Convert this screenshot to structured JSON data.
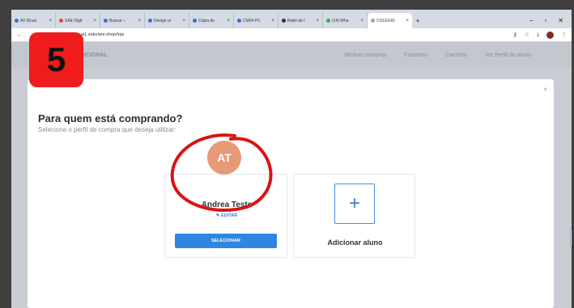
{
  "browser": {
    "tabs": [
      {
        "label": "AV Dicas"
      },
      {
        "label": "SAE Digit"
      },
      {
        "label": "Buscar –"
      },
      {
        "label": "Design ui"
      },
      {
        "label": "Cópia do"
      },
      {
        "label": "CM24-PC"
      },
      {
        "label": "Robô de I"
      },
      {
        "label": "(14) Wha"
      },
      {
        "label": "COLÉGIO"
      }
    ],
    "new_tab": "+",
    "minimize": "−",
    "maximize": "▫",
    "close": "✕",
    "url": "ai1.eskolare.shop/loja"
  },
  "site": {
    "brand": "ADICIONAL",
    "links": [
      "Minhas compras",
      "Favoritos",
      "Carrinho",
      "Ver Perfil do aluno"
    ]
  },
  "modal": {
    "close": "×",
    "title": "Para quem está comprando?",
    "subtitle": "Selecione o perfil de compra que deseja utilizar:",
    "profile": {
      "initials": "AT",
      "name": "Andrea Teste",
      "edit": "EDITAR",
      "select_button": "SELECIONAR"
    },
    "add_card": {
      "plus": "+",
      "label": "Adicionar aluno"
    }
  },
  "step_badge": "5",
  "colors": {
    "badge": "#ee1c1c",
    "primary": "#2f86e0",
    "avatar": "#e69a78",
    "annotation": "#d81414"
  }
}
